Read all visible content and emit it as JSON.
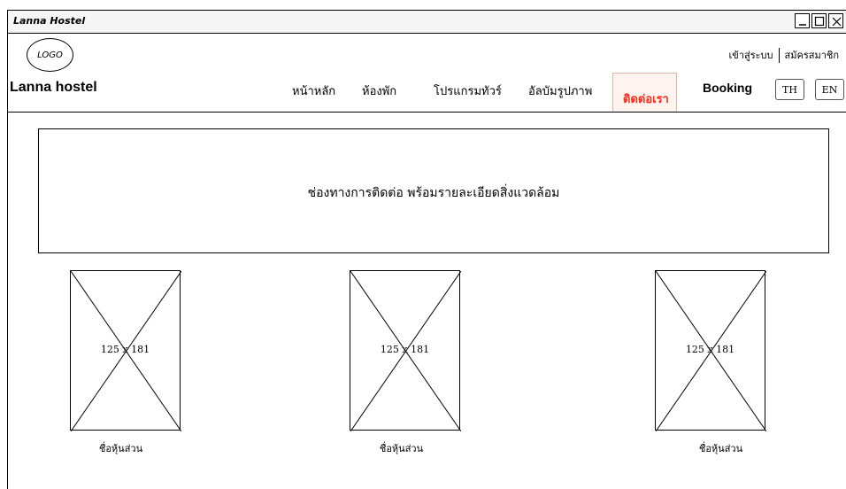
{
  "window": {
    "title": "Lanna Hostel"
  },
  "header": {
    "logo_text": "LOGO",
    "brand": "Lanna hostel",
    "login": "เข้าสู่ระบบ",
    "register": "สมัครสมาชิก"
  },
  "nav": {
    "items": [
      {
        "label": "หน้าหลัก"
      },
      {
        "label": "ห้องพัก"
      },
      {
        "label": "โปรแกรมทัวร์"
      },
      {
        "label": "อัลบัมรูปภาพ"
      },
      {
        "label": "ติดต่อเรา"
      }
    ],
    "active": "ติดต่อเรา",
    "booking": "Booking",
    "lang_th": "TH",
    "lang_en": "EN",
    "active_color": "#ff2a1a"
  },
  "main": {
    "content_text": "ช่องทางการติดต่อ พร้อมรายละเอียดสิ่งแวดล้อม",
    "partners": [
      {
        "image_label": "125 x 181",
        "caption": "ชื่อหุ้นส่วน"
      },
      {
        "image_label": "125 x 181",
        "caption": "ชื่อหุ้นส่วน"
      },
      {
        "image_label": "125 x 181",
        "caption": "ชื่อหุ้นส่วน"
      }
    ]
  }
}
